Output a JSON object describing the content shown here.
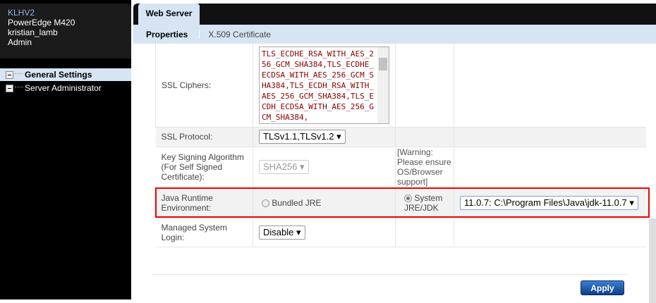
{
  "sidebar": {
    "host": "KLHV2",
    "model": "PowerEdge M420",
    "user": "kristian_lamb",
    "role": "Admin",
    "items": [
      {
        "label": "General Settings"
      },
      {
        "label": "Server Administrator"
      }
    ]
  },
  "tabs": {
    "main": "Web Server",
    "sub": [
      "Properties",
      "X.509 Certificate"
    ]
  },
  "form": {
    "ssl_ciphers": {
      "label": "SSL Ciphers:",
      "value": "TLS_ECDHE_RSA_WITH_AES_256_GCM_SHA384,TLS_ECDHE_ECDSA_WITH_AES_256_GCM_SHA384,TLS_ECDH_RSA_WITH_AES_256_GCM_SHA384,TLS_ECDH_ECDSA_WITH_AES_256_GCM_SHA384,"
    },
    "ssl_protocol": {
      "label": "SSL Protocol:",
      "value": "TLSv1.1,TLSv1.2"
    },
    "key_signing": {
      "label": "Key Signing Algorithm (For Self Signed Certificate):",
      "value": "SHA256",
      "warning": "[Warning: Please ensure OS/Browser support]"
    },
    "jre": {
      "label": "Java Runtime Environment:",
      "bundled": "Bundled JRE",
      "system": "System JRE/JDK",
      "value": "11.0.7: C:\\Program Files\\Java\\jdk-11.0.7"
    },
    "managed_login": {
      "label": "Managed System Login:",
      "value": "Disable"
    }
  },
  "apply_label": "Apply",
  "colors": {
    "highlight": "#e00000",
    "tab": "#d6e4f4"
  }
}
